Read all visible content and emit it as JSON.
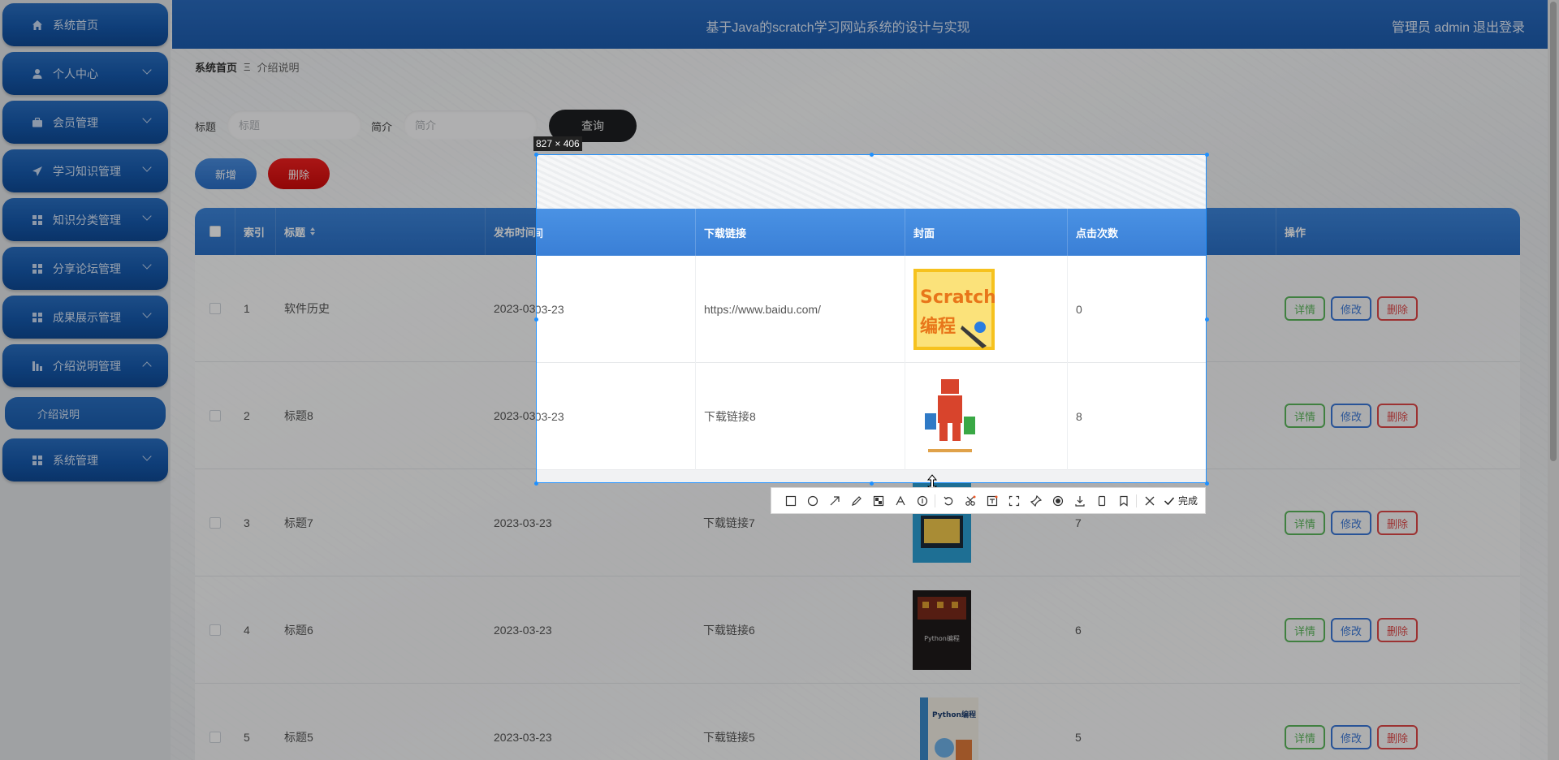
{
  "app": {
    "title": "基于Java的scratch学习网站系统的设计与实现",
    "user_label": "管理员 admin",
    "logout_label": "退出登录"
  },
  "sidebar": {
    "items": [
      {
        "label": "系统首页",
        "icon": "home-icon"
      },
      {
        "label": "个人中心",
        "icon": "person-icon"
      },
      {
        "label": "会员管理",
        "icon": "briefcase-icon"
      },
      {
        "label": "学习知识管理",
        "icon": "paper-plane-icon"
      },
      {
        "label": "知识分类管理",
        "icon": "grid-icon"
      },
      {
        "label": "分享论坛管理",
        "icon": "grid-icon"
      },
      {
        "label": "成果展示管理",
        "icon": "grid-icon"
      },
      {
        "label": "介绍说明管理",
        "icon": "bar-chart-icon"
      },
      {
        "label": "系统管理",
        "icon": "grid-icon"
      }
    ],
    "submenu": {
      "label": "介绍说明"
    }
  },
  "breadcrumb": {
    "home": "系统首页",
    "separator": "Ξ",
    "current": "介绍说明"
  },
  "search": {
    "title_label": "标题",
    "title_placeholder": "标题",
    "intro_label": "简介",
    "intro_placeholder": "简介",
    "query_label": "查询"
  },
  "actions": {
    "add_label": "新增",
    "delete_label": "删除"
  },
  "table": {
    "headers": {
      "index": "索引",
      "title": "标题",
      "publish_time": "发布时间",
      "download_link": "下载链接",
      "cover": "封面",
      "clicks": "点击次数",
      "actions": "操作"
    },
    "op_labels": {
      "detail": "详情",
      "edit": "修改",
      "remove": "删除"
    },
    "rows": [
      {
        "index": "1",
        "title": "软件历史",
        "publish_time": "2023-03-23",
        "download_link": "https://www.baidu.com/",
        "clicks": "0",
        "cover_text": [
          "Scratch",
          "编程"
        ]
      },
      {
        "index": "2",
        "title": "标题8",
        "publish_time": "2023-03-23",
        "download_link": "下载链接8",
        "clicks": "8",
        "cover_text": [
          "",
          ""
        ]
      },
      {
        "index": "3",
        "title": "标题7",
        "publish_time": "2023-03-23",
        "download_link": "下载链接7",
        "clicks": "7",
        "cover_text": [
          "",
          ""
        ]
      },
      {
        "index": "4",
        "title": "标题6",
        "publish_time": "2023-03-23",
        "download_link": "下载链接6",
        "clicks": "6",
        "cover_text": [
          "Python编程",
          ""
        ]
      },
      {
        "index": "5",
        "title": "标题5",
        "publish_time": "2023-03-23",
        "download_link": "下载链接5",
        "clicks": "5",
        "cover_text": [
          "Python编程",
          ""
        ]
      }
    ]
  },
  "capture": {
    "size_label": "827 × 406",
    "done_label": "完成"
  },
  "colors": {
    "brand_blue": "#1d5db0",
    "danger_red": "#e00e0e",
    "success_green": "#5cb85c"
  }
}
